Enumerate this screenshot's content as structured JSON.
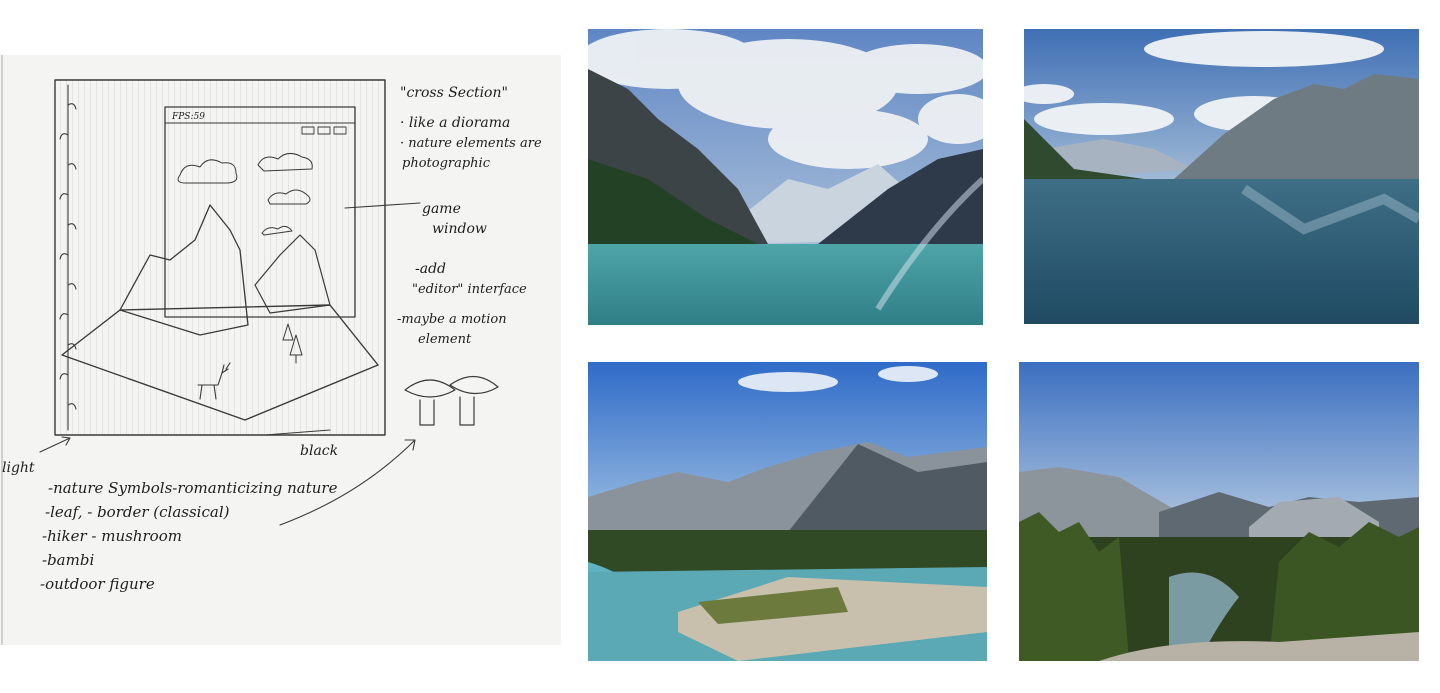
{
  "sketch": {
    "game_hud": "FPS:59",
    "notes": [
      {
        "id": "cross-section",
        "text": "\"cross Section\""
      },
      {
        "id": "diorama",
        "text": "· like a diorama"
      },
      {
        "id": "nature-photo-1",
        "text": "· nature elements are"
      },
      {
        "id": "nature-photo-2",
        "text": "photographic"
      },
      {
        "id": "game-window-1",
        "text": "game"
      },
      {
        "id": "game-window-2",
        "text": "window"
      },
      {
        "id": "add-editor-1",
        "text": "-add"
      },
      {
        "id": "add-editor-2",
        "text": "\"editor\" interface"
      },
      {
        "id": "motion-1",
        "text": "-maybe a motion"
      },
      {
        "id": "motion-2",
        "text": "element"
      },
      {
        "id": "light",
        "text": "light"
      },
      {
        "id": "black",
        "text": "black"
      }
    ],
    "list": [
      "-nature Symbols-romanticizing nature",
      "-leaf, - border (classical)",
      "-hiker    - mushroom",
      "-bambi",
      "-outdoor figure"
    ]
  },
  "photos": [
    {
      "id": "lake-louise",
      "kind": "photo"
    },
    {
      "id": "lake-minnewanka",
      "kind": "photo"
    },
    {
      "id": "river-valley",
      "kind": "photo"
    },
    {
      "id": "forest-overlook",
      "kind": "photo"
    }
  ]
}
